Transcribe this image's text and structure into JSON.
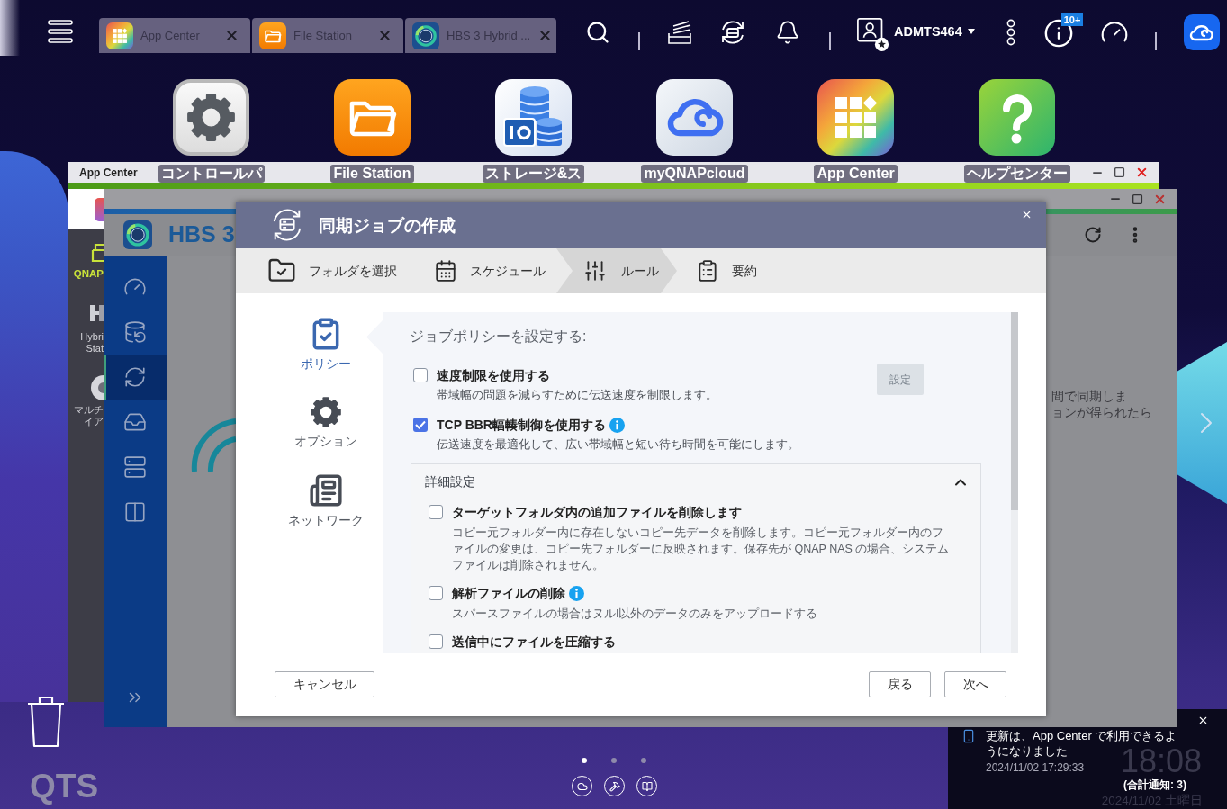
{
  "top_bar": {
    "tabs": [
      {
        "label": "App Center",
        "kind": "grid",
        "selected": false
      },
      {
        "label": "File Station",
        "kind": "folder",
        "selected": false
      },
      {
        "label": "HBS 3 Hybrid ...",
        "kind": "sync",
        "selected": false
      }
    ],
    "user": "ADMTS464",
    "notification_badge": "10+"
  },
  "desktop_icons": [
    {
      "label": "コントロールパ",
      "kind": "settings"
    },
    {
      "label": "File Station",
      "kind": "folder"
    },
    {
      "label": "ストレージ&ス",
      "kind": "storage"
    },
    {
      "label": "myQNAPcloud",
      "kind": "cloud"
    },
    {
      "label": "App Center",
      "kind": "grid"
    },
    {
      "label": "ヘルプセンター",
      "kind": "help"
    }
  ],
  "app_center_window": {
    "title": "App Center",
    "sidebar_items": [
      {
        "kind": "qnap",
        "lines": [
          "QNAP"
        ]
      },
      {
        "kind": "hybrid",
        "lines": [
          "Hybri",
          "Stat"
        ]
      },
      {
        "kind": "media",
        "lines": [
          "マルチ",
          "イア"
        ]
      }
    ]
  },
  "hbs_window": {
    "title": "HBS 3",
    "nav": [
      {
        "kind": "dashboard",
        "selected": false
      },
      {
        "kind": "backup",
        "selected": false
      },
      {
        "kind": "sync",
        "selected": true
      },
      {
        "kind": "restore",
        "selected": false
      },
      {
        "kind": "storage",
        "selected": false
      },
      {
        "kind": "services",
        "selected": false
      }
    ],
    "background_text": [
      "間で同期しま",
      "ョンが得られたら"
    ]
  },
  "dialog": {
    "title": "同期ジョブの作成",
    "steps": [
      {
        "label": "フォルダを選択",
        "kind": "folder",
        "selected": false
      },
      {
        "label": "スケジュール",
        "kind": "schedule",
        "selected": false
      },
      {
        "label": "ルール",
        "kind": "rules",
        "selected": true
      },
      {
        "label": "要約",
        "kind": "summary",
        "selected": false
      }
    ],
    "side_nav": [
      {
        "label": "ポリシー",
        "kind": "policy",
        "selected": true
      },
      {
        "label": "オプション",
        "kind": "options",
        "selected": false
      },
      {
        "label": "ネットワーク",
        "kind": "network",
        "selected": false
      }
    ],
    "heading": "ジョブポリシーを設定する:",
    "policies": [
      {
        "label": "速度制限を使用する",
        "checked": false,
        "info": false,
        "description": "帯域幅の問題を減らすために伝送速度を制限します。",
        "button": {
          "label": "設定",
          "disabled": true
        }
      },
      {
        "label": "TCP BBR輻輳制御を使用する",
        "checked": true,
        "info": true,
        "description": "伝送速度を最適化して、広い帯域幅と短い待ち時間を可能にします。"
      }
    ],
    "advanced": {
      "title": "詳細設定",
      "expanded": true,
      "items": [
        {
          "label": "ターゲットフォルダ内の追加ファイルを削除します",
          "checked": false,
          "info": false,
          "description": "コピー元フォルダー内に存在しないコピー先データを削除します。コピー元フォルダー内のファイルの変更は、コピー先フォルダーに反映されます。保存先が QNAP NAS の場合、システムファイルは削除されません。"
        },
        {
          "label": "解析ファイルの削除",
          "checked": false,
          "info": true,
          "description": "スパースファイルの場合はヌルI以外のデータのみをアップロードする"
        },
        {
          "label": "送信中にファイルを圧縮する",
          "checked": false,
          "info": false
        }
      ]
    },
    "buttons": {
      "cancel": "キャンセル",
      "back": "戻る",
      "next": "次へ"
    }
  },
  "desktop": {
    "brand": "QTS",
    "pages": [
      {
        "selected": true
      },
      {
        "selected": false
      },
      {
        "selected": false
      }
    ]
  },
  "notification": {
    "message": "更新は、App Center で利用できるようになりました",
    "time": "2024/11/02 17:29:33",
    "total": "(合計通知: 3)"
  },
  "clock": {
    "time": "18:08",
    "date": "2024/11/02 土曜日"
  }
}
